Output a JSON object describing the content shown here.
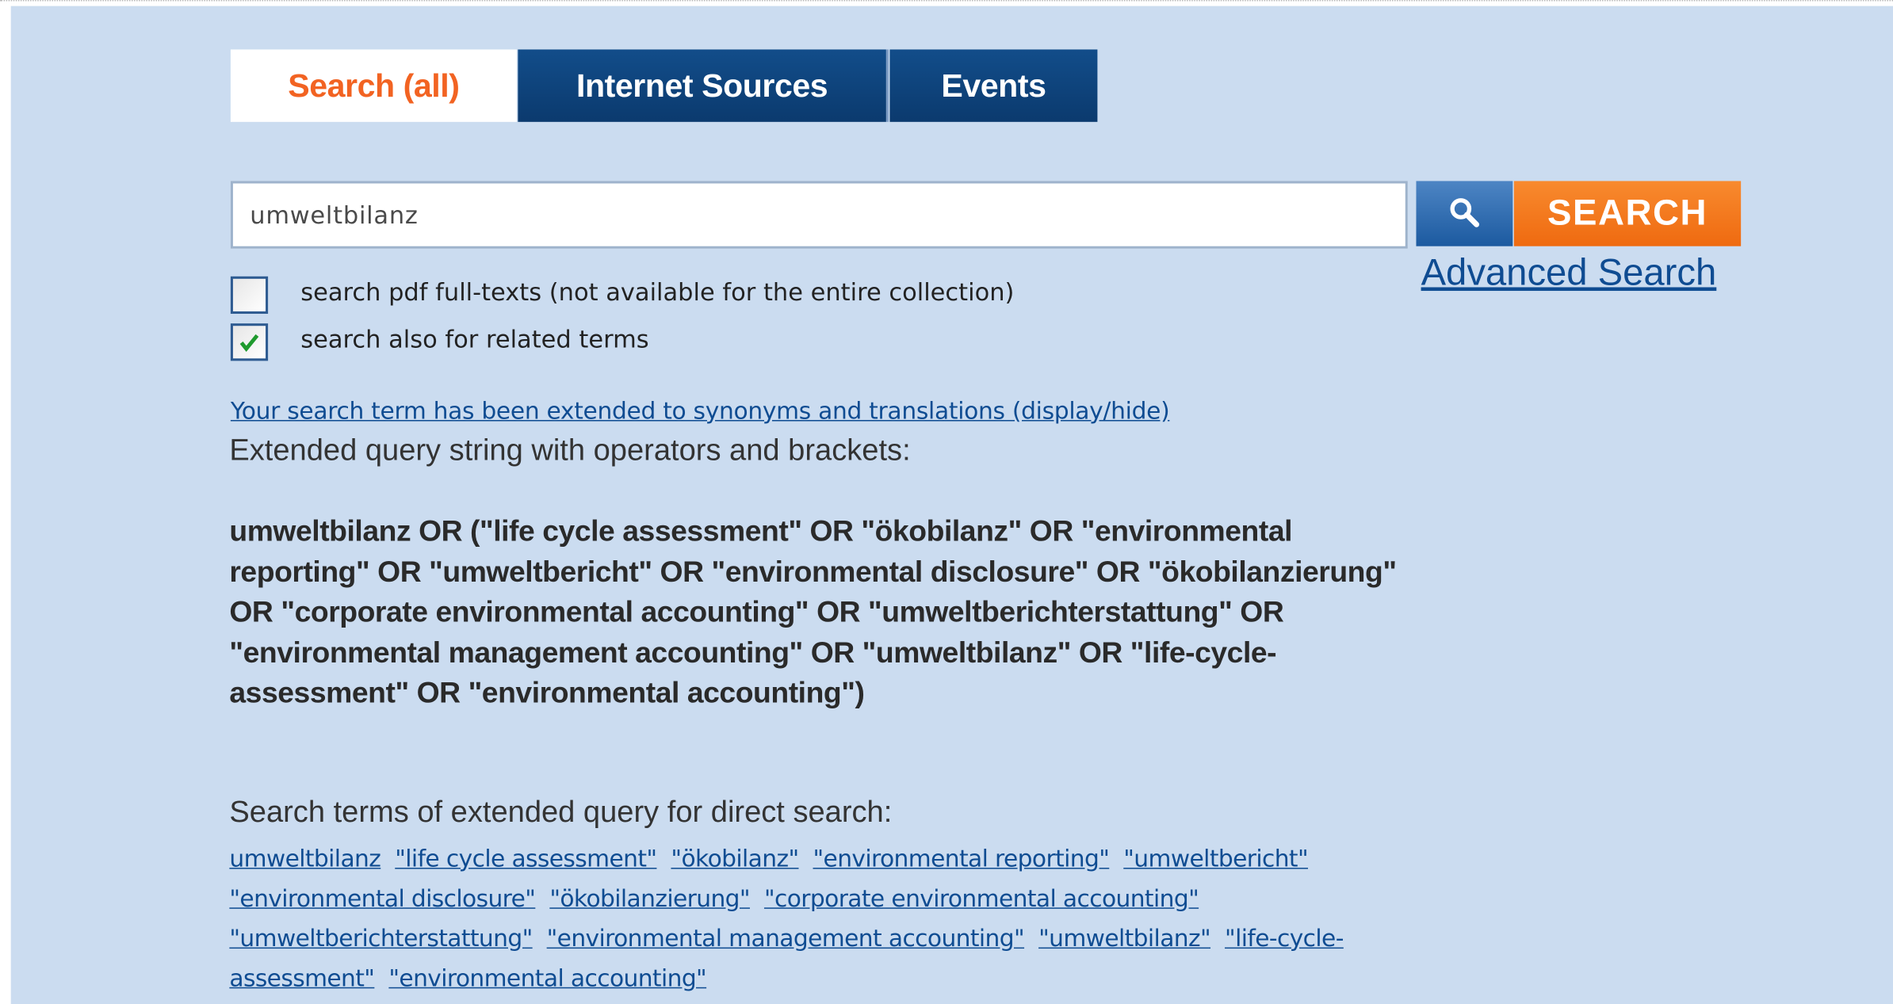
{
  "tabs": [
    {
      "label": "Search (all)",
      "active": true
    },
    {
      "label": "Internet Sources",
      "active": false
    },
    {
      "label": "Events",
      "active": false
    }
  ],
  "search": {
    "value": "umweltbilanz",
    "button_label": "SEARCH",
    "advanced_label": "Advanced Search",
    "icon": "search-icon"
  },
  "options": {
    "pdf_label": "search pdf full-texts (not available for the entire collection)",
    "pdf_checked": false,
    "related_label": "search also for related terms",
    "related_checked": true
  },
  "extended": {
    "toggle_link": "Your search term has been extended to synonyms and translations (display/hide)",
    "heading": "Extended query string with operators and brackets:",
    "query": "umweltbilanz OR (\"life cycle assessment\" OR \"ökobilanz\" OR \"environmental reporting\" OR \"umweltbericht\" OR \"environmental disclosure\" OR \"ökobilanzierung\" OR \"corporate environmental accounting\" OR \"umweltberichterstattung\" OR \"environmental management accounting\" OR \"umweltbilanz\" OR \"life-cycle-assessment\" OR \"environmental accounting\")",
    "direct_heading": "Search terms of extended query for direct search:",
    "terms": [
      "umweltbilanz",
      "\"life cycle assessment\"",
      "\"ökobilanz\"",
      "\"environmental reporting\"",
      "\"umweltbericht\"",
      "\"environmental disclosure\"",
      "\"ökobilanzierung\"",
      "\"corporate environmental accounting\"",
      "\"umweltberichterstattung\"",
      "\"environmental management accounting\"",
      "\"umweltbilanz\"",
      "\"life-cycle-assessment\"",
      "\"environmental accounting\""
    ]
  },
  "colors": {
    "panel_bg": "#cbdcf0",
    "active_tab_text": "#f26322",
    "tab_bg": "#0b3a6e",
    "search_button_bg": "#ef6a10",
    "link": "#0f4c92"
  }
}
